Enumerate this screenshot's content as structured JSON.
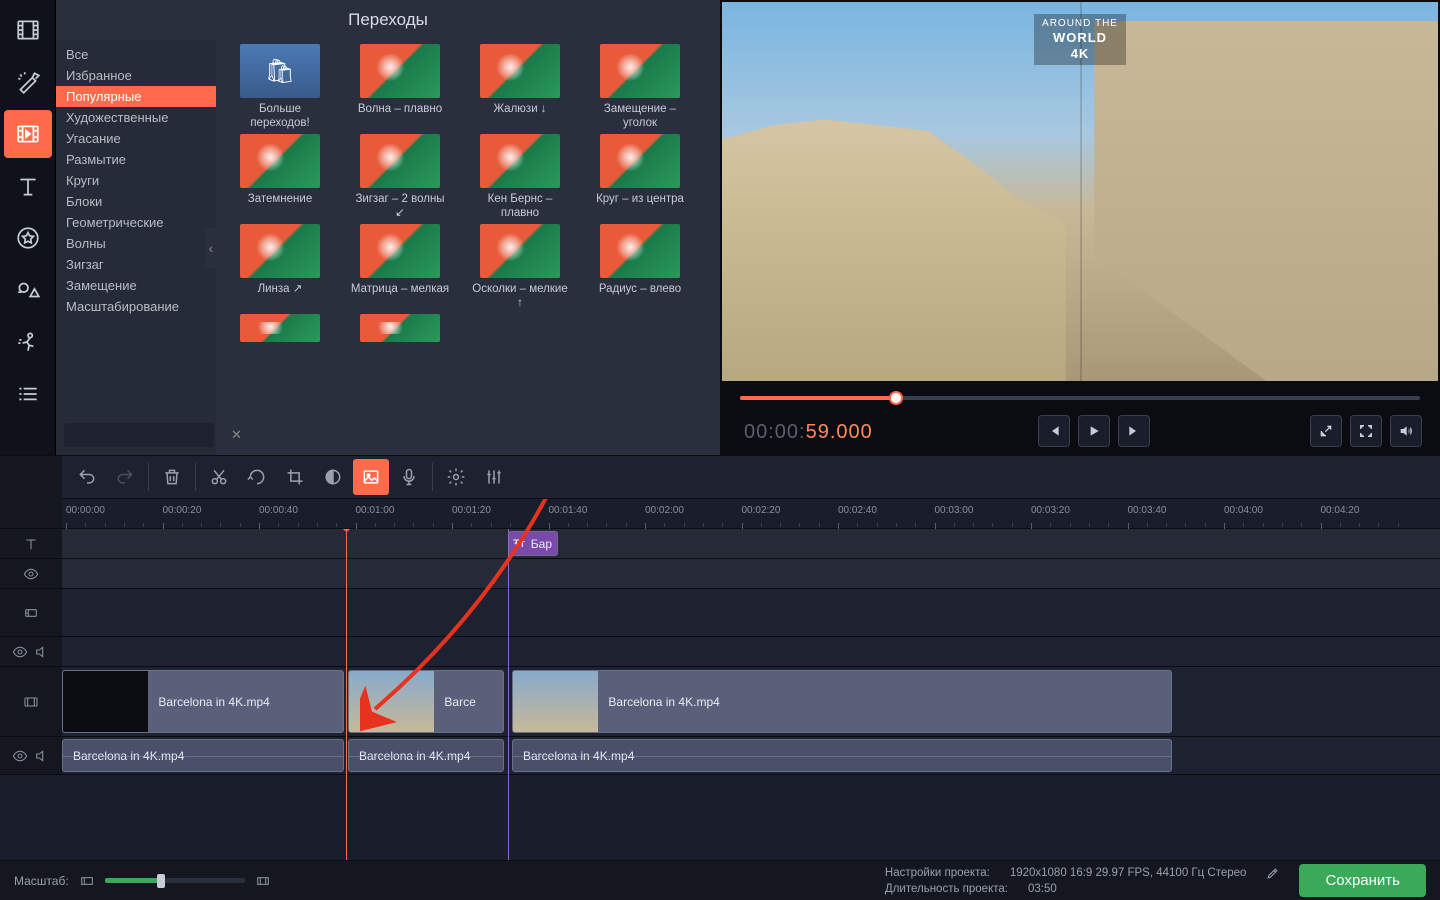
{
  "leftTools": [
    "media",
    "fx",
    "transitions",
    "text",
    "stickers",
    "shapes",
    "motion",
    "list"
  ],
  "browser": {
    "title": "Переходы",
    "categories": [
      "Все",
      "Избранное",
      "Популярные",
      "Художественные",
      "Угасание",
      "Размытие",
      "Круги",
      "Блоки",
      "Геометрические",
      "Волны",
      "Зигзаг",
      "Замещение",
      "Масштабирование"
    ],
    "activeCategory": 2,
    "searchPlaceholder": "",
    "transitions": [
      [
        {
          "label": "Больше переходов!",
          "type": "more"
        },
        {
          "label": "Волна – плавно"
        },
        {
          "label": "Жалюзи ↓"
        },
        {
          "label": "Замещение – уголок"
        }
      ],
      [
        {
          "label": "Затемнение"
        },
        {
          "label": "Зигзаг – 2 волны ↙"
        },
        {
          "label": "Кен Бернс – плавно"
        },
        {
          "label": "Круг – из центра"
        }
      ],
      [
        {
          "label": "Линза ↗"
        },
        {
          "label": "Матрица – мелкая"
        },
        {
          "label": "Осколки – мелкие ↑"
        },
        {
          "label": "Радиус – влево"
        }
      ],
      [
        {
          "label": "",
          "partial": true
        },
        {
          "label": "",
          "partial": true
        }
      ]
    ]
  },
  "preview": {
    "watermark_top": "AROUND THE",
    "watermark_main": "WORLD",
    "watermark_sub": "4K",
    "timecode_gray": "00:00:",
    "timecode_orange": "59.000"
  },
  "ruler": [
    "00:00:00",
    "00:00:20",
    "00:00:40",
    "00:01:00",
    "00:01:20",
    "00:01:40",
    "00:02:00",
    "00:02:20",
    "00:02:40",
    "00:03:00",
    "00:03:20",
    "00:03:40",
    "00:04:00",
    "00:04:20"
  ],
  "clips": {
    "titleClip": {
      "label": "Бар"
    },
    "video": [
      {
        "label": "Barcelona in 4K.mp4"
      },
      {
        "label": "Barce"
      },
      {
        "label": "Barcelona in 4K.mp4"
      }
    ],
    "audio": [
      {
        "label": "Barcelona in 4K.mp4"
      },
      {
        "label": "Barcelona in 4K.mp4"
      },
      {
        "label": "Barcelona in 4K.mp4"
      }
    ]
  },
  "status": {
    "zoomLabel": "Масштаб:",
    "projSettingsLabel": "Настройки проекта:",
    "projSettingsValue": "1920x1080 16:9 29.97 FPS, 44100 Гц Стерео",
    "projDurationLabel": "Длительность проекта:",
    "projDurationValue": "03:50",
    "saveLabel": "Сохранить"
  }
}
